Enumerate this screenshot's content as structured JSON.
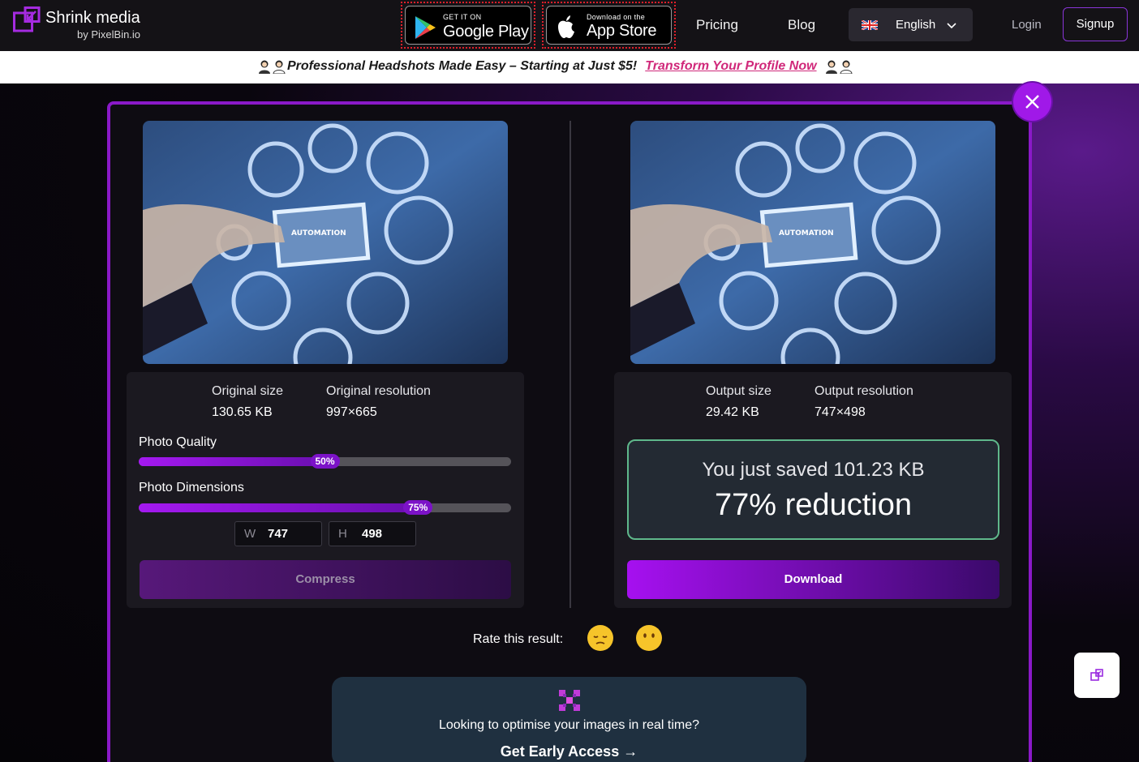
{
  "header": {
    "logo_title": "Shrink media",
    "logo_subtitle": "by PixelBin.io",
    "google_play": {
      "small": "GET IT ON",
      "big": "Google Play"
    },
    "app_store": {
      "small": "Download on the",
      "big": "App Store"
    },
    "nav": {
      "pricing": "Pricing",
      "blog": "Blog"
    },
    "language": "English",
    "login": "Login",
    "signup": "Signup"
  },
  "promo": {
    "text": "Professional Headshots Made Easy – Starting at Just $5!",
    "link": "Transform Your Profile Now"
  },
  "original": {
    "size_label": "Original size",
    "size_value": "130.65 KB",
    "resolution_label": "Original resolution",
    "resolution_value": "997×665",
    "quality_label": "Photo Quality",
    "quality_percent": 50,
    "quality_badge": "50%",
    "dimensions_label": "Photo Dimensions",
    "dimensions_percent": 75,
    "dimensions_badge": "75%",
    "width_letter": "W",
    "width_value": "747",
    "height_letter": "H",
    "height_value": "498",
    "compress_label": "Compress"
  },
  "output": {
    "size_label": "Output size",
    "size_value": "29.42 KB",
    "resolution_label": "Output resolution",
    "resolution_value": "747×498",
    "saved_prefix": "You just saved",
    "saved_value": "101.23 KB",
    "reduction": "77% reduction",
    "download_label": "Download"
  },
  "image_text": "AUTOMATION",
  "rating": {
    "label": "Rate this result:"
  },
  "cta": {
    "text": "Looking to optimise your images in real time?",
    "link": "Get Early Access →"
  },
  "colors": {
    "accent": "#a019e8",
    "success_border": "#5fb88b",
    "promo_link": "#d0287a"
  }
}
